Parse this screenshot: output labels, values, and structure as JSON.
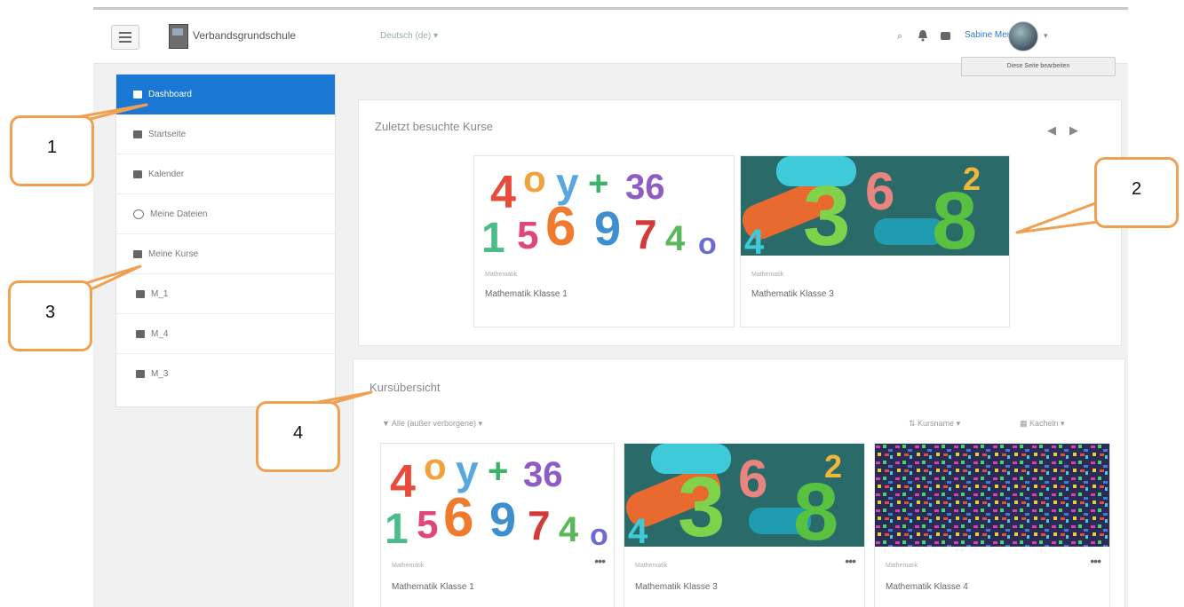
{
  "app": {
    "site_name": "Verbandsgrundschule",
    "language": "Deutsch (de) ▾",
    "user_name": "Sabine Merk",
    "edit_button": "Diese Seite bearbeiten"
  },
  "sidebar": {
    "items": [
      {
        "label": "Dashboard",
        "icon": "home-icon",
        "active": true
      },
      {
        "label": "Startseite",
        "icon": "house-icon"
      },
      {
        "label": "Kalender",
        "icon": "calendar-icon"
      },
      {
        "label": "Meine Dateien",
        "icon": "file-icon"
      },
      {
        "label": "Meine Kurse",
        "icon": "graduation-cap-icon"
      },
      {
        "label": "M_1",
        "icon": "graduation-cap-icon"
      },
      {
        "label": "M_4",
        "icon": "graduation-cap-icon"
      },
      {
        "label": "M_3",
        "icon": "graduation-cap-icon"
      }
    ]
  },
  "recent": {
    "title": "Zuletzt besuchte Kurse",
    "prev": "◀",
    "next": "▶",
    "courses": [
      {
        "category": "Mathematik",
        "name": "Mathematik Klasse 1"
      },
      {
        "category": "Mathematik",
        "name": "Mathematik Klasse 3"
      }
    ]
  },
  "overview": {
    "title": "Kursübersicht",
    "filter": "Alle (außer verborgene) ▾",
    "sort": "Kursname ▾",
    "view": "Kacheln ▾",
    "courses": [
      {
        "category": "Mathematik",
        "name": "Mathematik Klasse 1"
      },
      {
        "category": "Mathematik",
        "name": "Mathematik Klasse 3"
      },
      {
        "category": "Mathematik",
        "name": "Mathematik Klasse 4"
      }
    ]
  },
  "callouts": [
    "1",
    "2",
    "3",
    "4"
  ],
  "colors": {
    "accent": "#1a77d4",
    "callout": "#f0a050"
  }
}
